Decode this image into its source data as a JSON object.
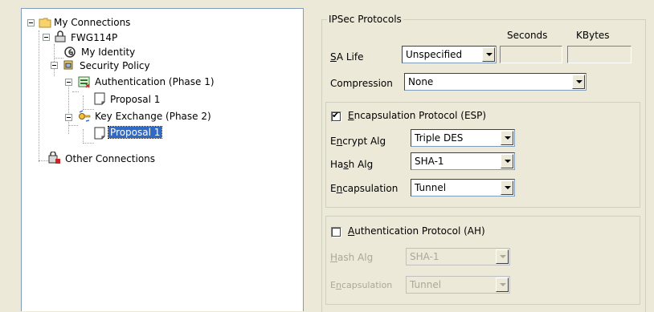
{
  "tree": {
    "my_connections": "My Connections",
    "fwg": "FWG114P",
    "my_identity": "My Identity",
    "security_policy": "Security Policy",
    "authentication": "Authentication (Phase 1)",
    "auth_proposal": "Proposal 1",
    "key_exchange": "Key Exchange (Phase 2)",
    "kx_proposal": "Proposal 1",
    "other_connections": "Other Connections"
  },
  "ipsec": {
    "legend": "IPSec Protocols",
    "seconds_header": "Seconds",
    "kbytes_header": "KBytes",
    "sa_life_label_u": "S",
    "sa_life_label_rest": "A Life",
    "sa_life_value": "Unspecified",
    "compression_label": "Compression",
    "compression_value": "None"
  },
  "esp": {
    "checked": true,
    "label_u": "E",
    "label_rest": "ncapsulation Protocol (ESP)",
    "encrypt_label_pre": "E",
    "encrypt_label_u": "n",
    "encrypt_label_post": "crypt Alg",
    "encrypt_value": "Triple DES",
    "hash_label_pre": "Ha",
    "hash_label_u": "s",
    "hash_label_post": "h Alg",
    "hash_value": "SHA-1",
    "encap_label_pre": "E",
    "encap_label_u": "n",
    "encap_label_post": "capsulation",
    "encap_value": "Tunnel"
  },
  "ah": {
    "checked": false,
    "label_u": "A",
    "label_rest": "uthentication Protocol (AH)",
    "hash_label_u": "H",
    "hash_label_rest": "ash Alg",
    "hash_value": "SHA-1",
    "encap_label_pre": "E",
    "encap_label_u": "n",
    "encap_label_post": "capsulation",
    "encap_value": "Tunnel"
  },
  "icons": {
    "folder": "folder-icon",
    "connection": "secure-connection-icon",
    "identity": "identity-icon",
    "policy": "security-policy-icon",
    "auth": "authentication-icon",
    "proposal": "proposal-icon",
    "key": "key-exchange-icon",
    "other": "other-connections-icon"
  }
}
